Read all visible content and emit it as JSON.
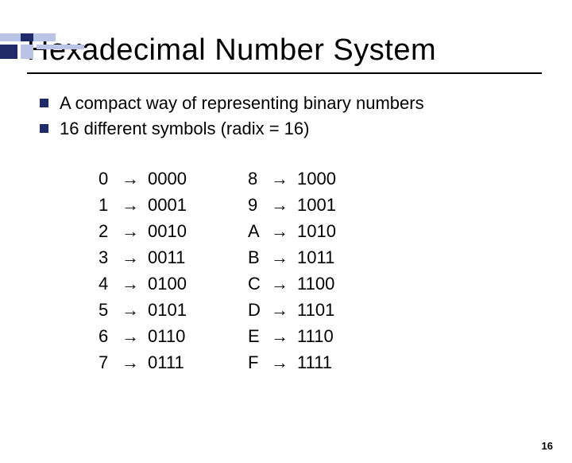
{
  "title": "Hexadecimal Number System",
  "bullets": [
    "A compact way of representing binary numbers",
    "16 different symbols (radix = 16)"
  ],
  "arrow": "→",
  "mapping_left": [
    {
      "hex": "0",
      "bin": "0000"
    },
    {
      "hex": "1",
      "bin": "0001"
    },
    {
      "hex": "2",
      "bin": "0010"
    },
    {
      "hex": "3",
      "bin": "0011"
    },
    {
      "hex": "4",
      "bin": "0100"
    },
    {
      "hex": "5",
      "bin": "0101"
    },
    {
      "hex": "6",
      "bin": "0110"
    },
    {
      "hex": "7",
      "bin": "0111"
    }
  ],
  "mapping_right": [
    {
      "hex": "8",
      "bin": "1000"
    },
    {
      "hex": "9",
      "bin": "1001"
    },
    {
      "hex": "A",
      "bin": "1010"
    },
    {
      "hex": "B",
      "bin": "1011"
    },
    {
      "hex": "C",
      "bin": "1100"
    },
    {
      "hex": "D",
      "bin": "1101"
    },
    {
      "hex": "E",
      "bin": "1110"
    },
    {
      "hex": "F",
      "bin": "1111"
    }
  ],
  "page_number": "16"
}
